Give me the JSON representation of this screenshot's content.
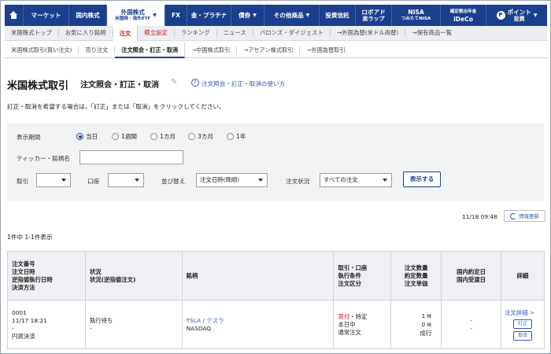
{
  "topnav": {
    "items": [
      {
        "label": "マーケット"
      },
      {
        "label": "国内株式"
      },
      {
        "label": "外国株式",
        "sub": "米国株・海外ETF"
      },
      {
        "label": "FX"
      },
      {
        "label": "金・プラチナ"
      },
      {
        "label": "債券"
      },
      {
        "label": "その他商品"
      },
      {
        "label": "投資信託"
      },
      {
        "label": "ロボアド",
        "sub": "楽ラップ"
      },
      {
        "label": "NISA",
        "sub": "つみたてNISA"
      },
      {
        "label": "確定拠出年金",
        "sub": "iDeCo"
      },
      {
        "label": "ポイント",
        "sub": "投資"
      }
    ]
  },
  "subnav": {
    "items": [
      {
        "label": "米国株式トップ"
      },
      {
        "label": "お気に入り銘柄"
      },
      {
        "label": "注文"
      },
      {
        "label": "積立設定"
      },
      {
        "label": "ランキング"
      },
      {
        "label": "ニュース"
      },
      {
        "label": "バロンズ・ダイジェスト"
      },
      {
        "label": "→外国為替(米ドル両替)"
      },
      {
        "label": "→保有商品一覧"
      }
    ]
  },
  "thirdnav": {
    "items": [
      {
        "label": "米国株式取引(買い注文)"
      },
      {
        "label": "売り注文"
      },
      {
        "label": "注文照会・訂正・取消"
      },
      {
        "label": "→中国株式取引"
      },
      {
        "label": "→アセアン株式取引"
      },
      {
        "label": "→外国為替取引"
      }
    ]
  },
  "page": {
    "title": "米国株式取引",
    "subtitle": "注文照会・訂正・取消",
    "help_link": "注文照会・訂正・取消の使い方",
    "instruction": "訂正・取消を希望する場合は、「訂正」または「取消」をクリックしてください。"
  },
  "filter": {
    "period_label": "表示期間",
    "period_options": [
      "当日",
      "1週間",
      "1カ月",
      "3カ月",
      "1年"
    ],
    "period_selected": "当日",
    "ticker_label": "ティッカー・銘柄名",
    "ticker_value": "",
    "trade_label": "取引",
    "trade_value": "",
    "account_label": "口座",
    "account_value": "",
    "sort_label": "並び替え",
    "sort_value": "注文日時(降順)",
    "status_label": "注文状況",
    "status_value": "すべての注文",
    "show_button": "表示する"
  },
  "meta": {
    "timestamp": "11/18 09:48",
    "refresh_label": "情報更新",
    "count_text": "1件中 1-1件表示"
  },
  "table": {
    "headers": {
      "col1": [
        "注文番号",
        "注文日時",
        "逆指値執行日時",
        "決済方法"
      ],
      "col2": [
        "状況",
        "状況(逆指値注文)"
      ],
      "col3": [
        "銘柄"
      ],
      "col4": [
        "取引・口座",
        "執行条件",
        "注文区分"
      ],
      "col5": [
        "注文数量",
        "約定数量",
        "注文単価"
      ],
      "col6": [
        "国内約定日",
        "国内受渡日"
      ],
      "col7": [
        "詳細"
      ]
    },
    "rows": [
      {
        "order_no": "0001",
        "order_datetime": "11/17 18:21",
        "stop_datetime": "-",
        "settlement": "円貨決済",
        "status": "執行待ち",
        "status_stop": "-",
        "ticker": "TSLA / テスラ",
        "market": "NASDAQ",
        "trade": "買付",
        "account": "・特定",
        "condition": "本日中",
        "order_type": "通常注文",
        "qty": "1",
        "qty_unit": "株",
        "filled": "0",
        "filled_unit": "株",
        "price": "成行",
        "domestic_trade_date": "-",
        "domestic_settle_date": "-",
        "detail_link": "注文詳細 >",
        "modify": "訂正",
        "cancel": "取消"
      }
    ]
  }
}
